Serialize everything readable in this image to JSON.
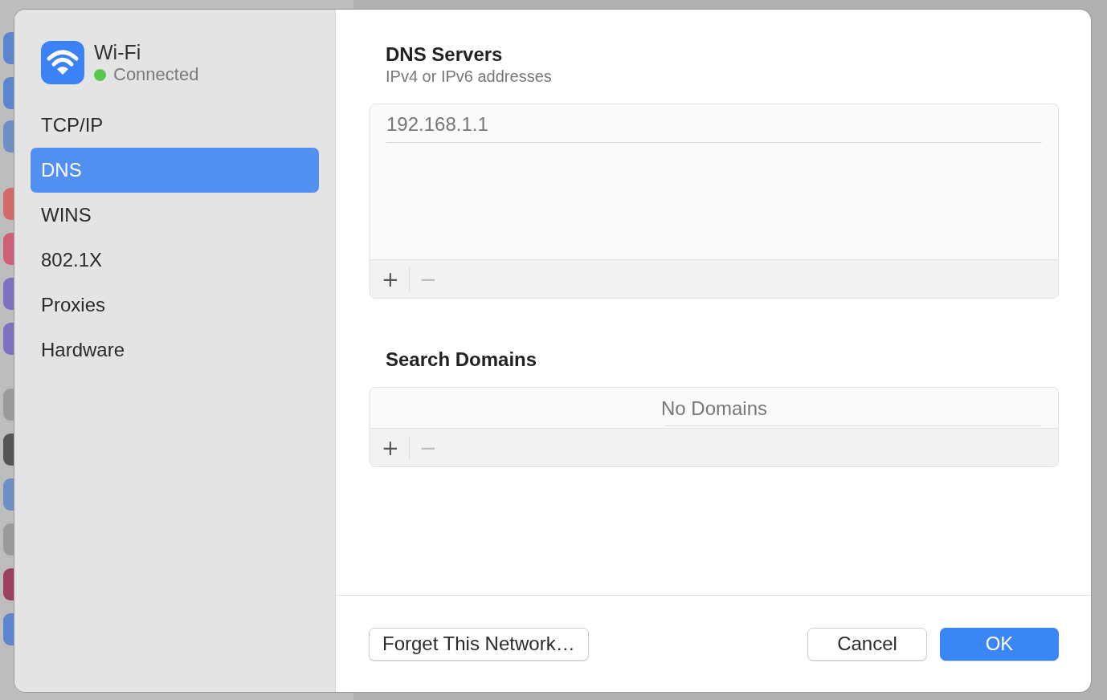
{
  "sidebar": {
    "service": {
      "name": "Wi-Fi",
      "status": "Connected",
      "connected": true
    },
    "items": [
      {
        "label": "TCP/IP",
        "selected": false
      },
      {
        "label": "DNS",
        "selected": true
      },
      {
        "label": "WINS",
        "selected": false
      },
      {
        "label": "802.1X",
        "selected": false
      },
      {
        "label": "Proxies",
        "selected": false
      },
      {
        "label": "Hardware",
        "selected": false
      }
    ]
  },
  "dns_servers": {
    "title": "DNS Servers",
    "subtitle": "IPv4 or IPv6 addresses",
    "entries": [
      "192.168.1.1"
    ],
    "add": "+",
    "remove": "−"
  },
  "search_domains": {
    "title": "Search Domains",
    "placeholder": "No Domains",
    "add": "+",
    "remove": "−"
  },
  "buttons": {
    "forget": "Forget This Network…",
    "cancel": "Cancel",
    "ok": "OK"
  }
}
